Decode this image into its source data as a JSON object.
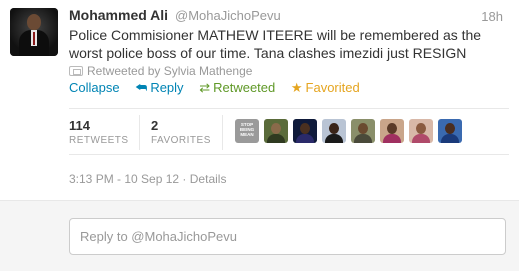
{
  "tweet": {
    "fullname": "Mohammed Ali",
    "username": "@MohaJichoPevu",
    "time_ago": "18h",
    "text": "Police Commisioner MATHEW ITEERE will be remembered as the worst police boss of our time. Tana clashes imezidi just RESIGN",
    "retweeted_by": "Retweeted by Sylvia Mathenge",
    "avatar_icon": "profile-photo"
  },
  "actions": [
    {
      "label": "Collapse",
      "icon": ""
    },
    {
      "label": "Reply",
      "icon": "reply-icon"
    },
    {
      "label": "Retweeted",
      "icon": "retweet-icon"
    },
    {
      "label": "Favorited",
      "icon": "star-icon"
    }
  ],
  "stats": {
    "retweets_count": "114",
    "retweets_label": "RETWEETS",
    "favorites_count": "2",
    "favorites_label": "FAVORITES",
    "stop_badge_text": "STOP BEING MEAN"
  },
  "details": {
    "timestamp": "3:13 PM - 10 Sep 12",
    "details_link": "Details"
  },
  "reply": {
    "placeholder": "Reply to @MohaJichoPevu"
  },
  "colors": {
    "link": "#0084b4",
    "retweeted": "#609928",
    "favorited": "#e5a520",
    "muted": "#999999"
  }
}
